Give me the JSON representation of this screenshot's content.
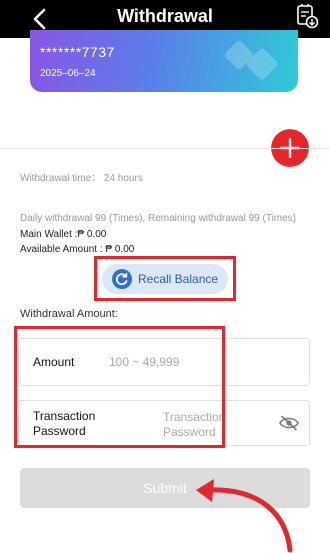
{
  "header": {
    "title": "Withdrawal",
    "back_icon": "chevron-left-icon",
    "records_icon": "document-download-icon"
  },
  "card": {
    "number": "*******7737",
    "date": "2025–06–24"
  },
  "withdrawal_time": "Withdrawal time： 24 hours",
  "daily_limit": "Daily withdrawal 99 (Times), Remaining withdrawal 99 (Times)",
  "main_wallet": "Main Wallet :₱ 0.00",
  "available_amount": "Available Amount : ₱ 0.00",
  "recall_balance": {
    "label": "Recall Balance",
    "icon": "refresh-icon"
  },
  "form": {
    "title": "Withdrawal Amount:",
    "amount_label": "Amount",
    "amount_placeholder": "100 ~ 49,999",
    "password_label_line1": "Transaction",
    "password_label_line2": "Password",
    "password_placeholder_line1": "Transaction",
    "password_placeholder_line2": "Password",
    "password_visibility_icon": "eye-off-icon"
  },
  "submit_label": "Submit",
  "colors": {
    "header_bg": "#000000",
    "accent_red": "#e8262a",
    "recall_bg": "#dde8f6",
    "recall_text": "#2b5cae",
    "submit_disabled": "#dcdcdc"
  }
}
